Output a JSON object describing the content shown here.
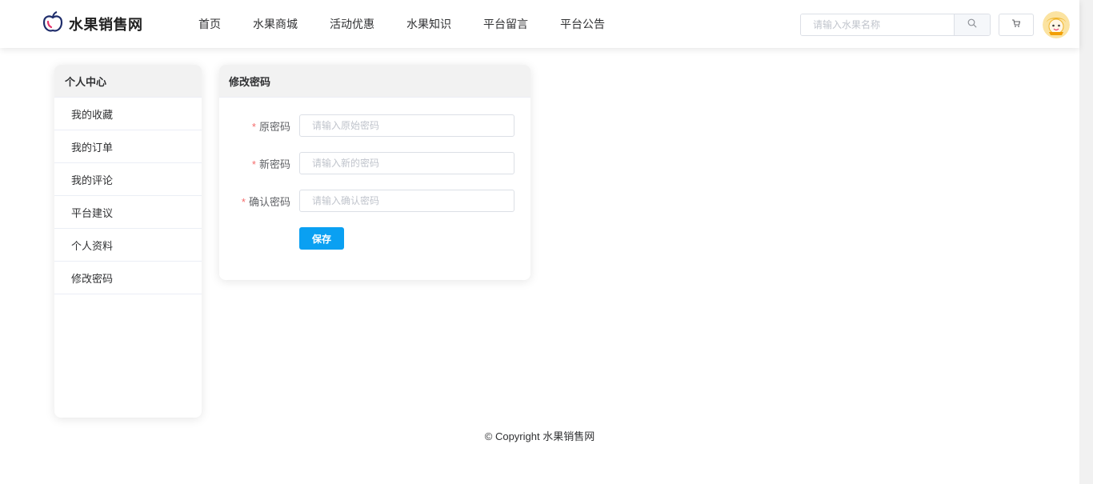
{
  "brand": {
    "name": "水果销售网"
  },
  "nav": {
    "items": [
      "首页",
      "水果商城",
      "活动优惠",
      "水果知识",
      "平台留言",
      "平台公告"
    ]
  },
  "search": {
    "placeholder": "请输入水果名称",
    "icon": "search-icon"
  },
  "cart": {
    "icon": "cart-icon"
  },
  "sidebar": {
    "title": "个人中心",
    "items": [
      "我的收藏",
      "我的订单",
      "我的评论",
      "平台建议",
      "个人资料",
      "修改密码"
    ]
  },
  "password_form": {
    "title": "修改密码",
    "required_mark": "*",
    "fields": [
      {
        "label": "原密码",
        "placeholder": "请输入原始密码",
        "value": ""
      },
      {
        "label": "新密码",
        "placeholder": "请输入新的密码",
        "value": ""
      },
      {
        "label": "确认密码",
        "placeholder": "请输入确认密码",
        "value": ""
      }
    ],
    "save_label": "保存"
  },
  "footer": {
    "text": "© Copyright 水果销售网"
  },
  "colors": {
    "accent": "#0aa0f2",
    "required": "#f56c6c",
    "panel_header": "#f2f2f2",
    "border": "#dcdfe6"
  }
}
